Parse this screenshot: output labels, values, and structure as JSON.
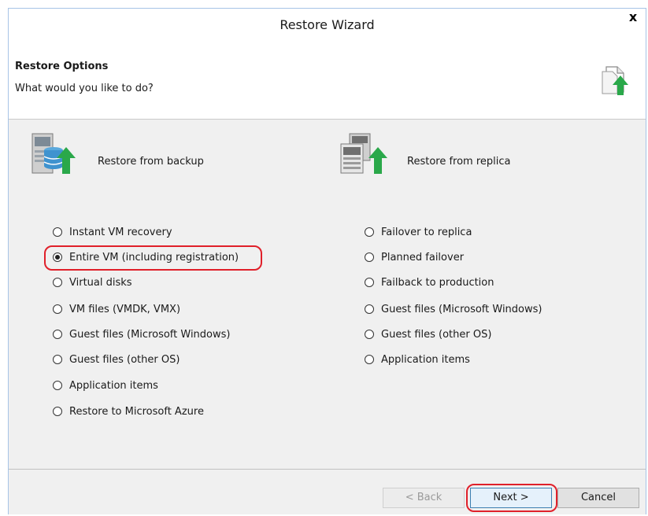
{
  "window": {
    "title": "Restore Wizard",
    "close_label": "x"
  },
  "header": {
    "title": "Restore Options",
    "subtitle": "What would you like to do?"
  },
  "backup": {
    "title": "Restore from backup",
    "options": [
      {
        "label": "Instant VM recovery",
        "selected": false
      },
      {
        "label": "Entire VM (including registration)",
        "selected": true
      },
      {
        "label": "Virtual disks",
        "selected": false
      },
      {
        "label": "VM files (VMDK, VMX)",
        "selected": false
      },
      {
        "label": "Guest files (Microsoft Windows)",
        "selected": false
      },
      {
        "label": "Guest files (other OS)",
        "selected": false
      },
      {
        "label": "Application items",
        "selected": false
      },
      {
        "label": "Restore to Microsoft Azure",
        "selected": false
      }
    ]
  },
  "replica": {
    "title": "Restore from replica",
    "options": [
      {
        "label": "Failover to replica",
        "selected": false
      },
      {
        "label": "Planned failover",
        "selected": false
      },
      {
        "label": "Failback to production",
        "selected": false
      },
      {
        "label": "Guest files (Microsoft Windows)",
        "selected": false
      },
      {
        "label": "Guest files (other OS)",
        "selected": false
      },
      {
        "label": "Application items",
        "selected": false
      }
    ]
  },
  "buttons": {
    "back": "< Back",
    "next": "Next >",
    "cancel": "Cancel"
  },
  "colors": {
    "highlight": "#e0202a",
    "arrow_green": "#2aa84a",
    "content_bg": "#f0f0f0"
  }
}
